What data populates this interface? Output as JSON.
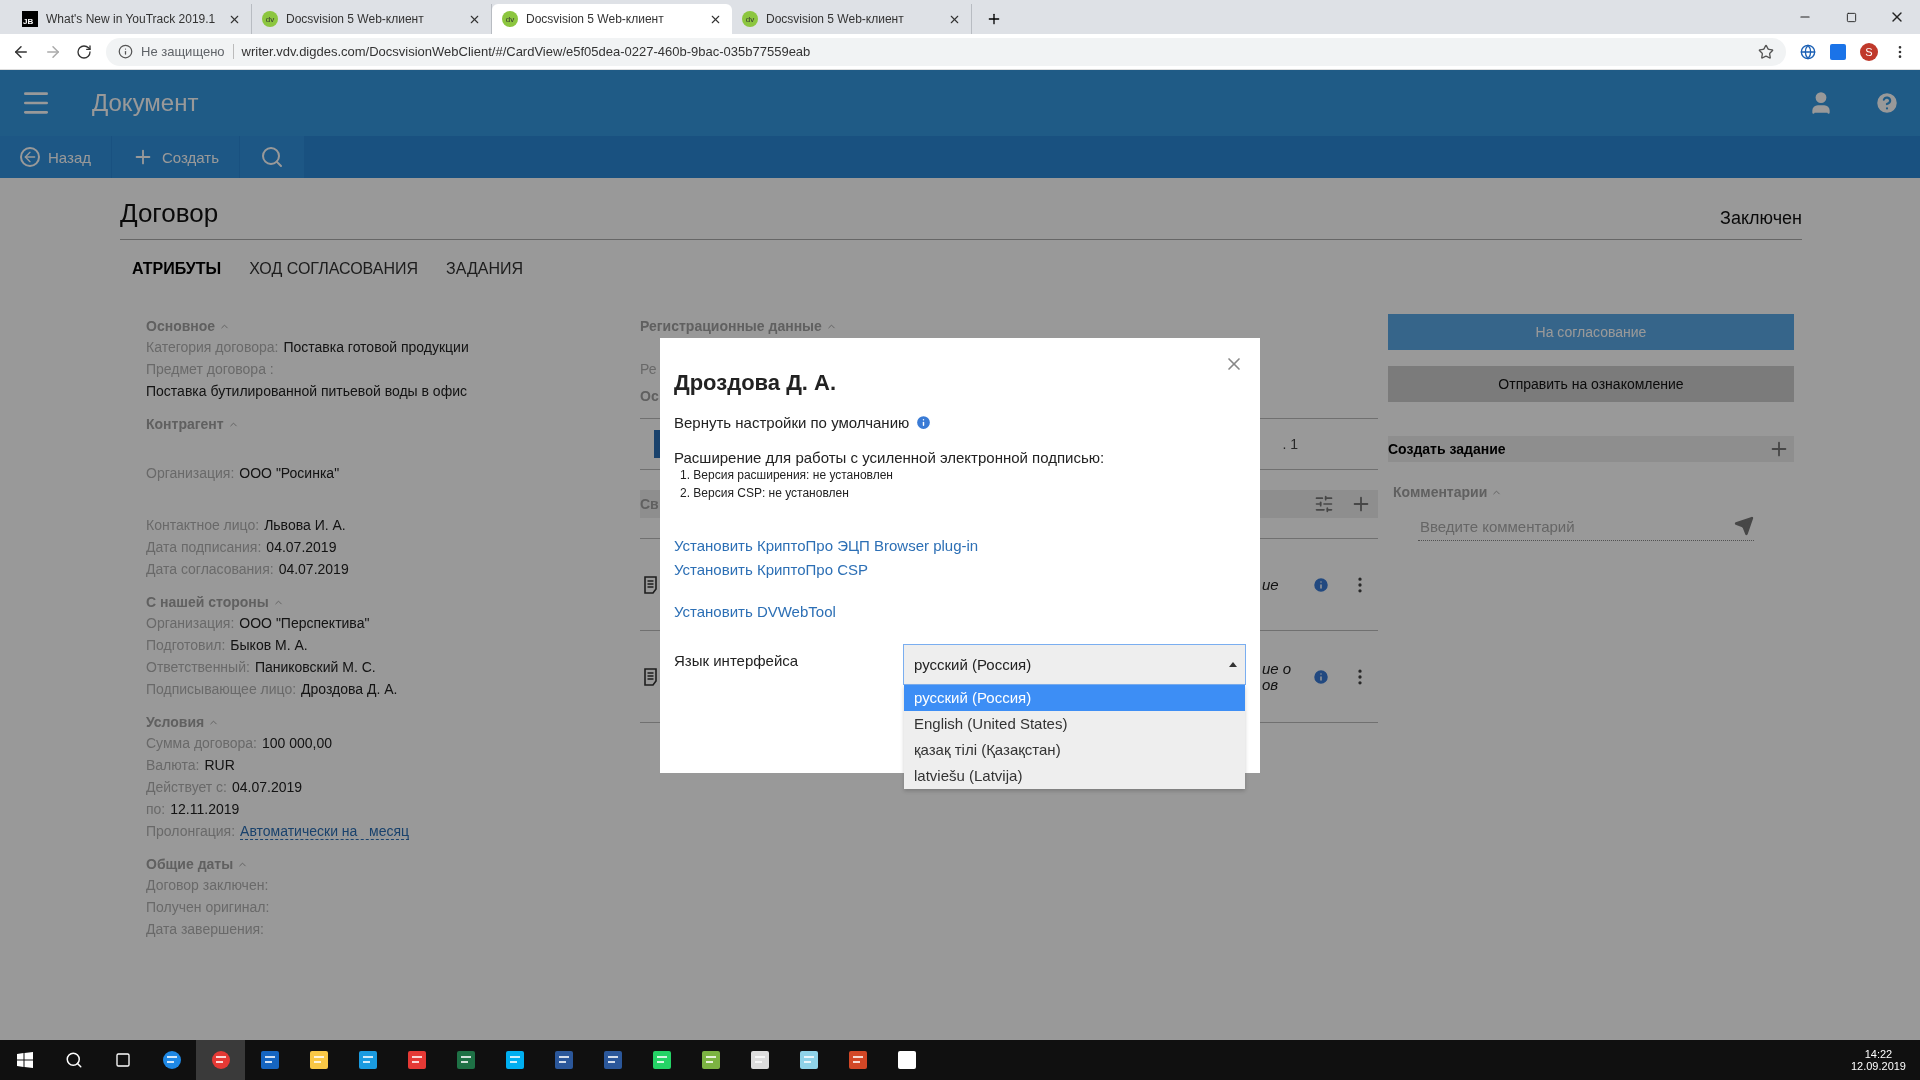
{
  "browser": {
    "tabs": [
      {
        "kind": "jb",
        "badge": "JB",
        "label": "What's New in YouTrack 2019.1",
        "selected": false
      },
      {
        "kind": "dv",
        "badge": "dv",
        "label": "Docsvision 5 Web-клиент",
        "selected": false
      },
      {
        "kind": "dv",
        "badge": "dv",
        "label": "Docsvision 5 Web-клиент",
        "selected": true
      },
      {
        "kind": "dv",
        "badge": "dv",
        "label": "Docsvision 5 Web-клиент",
        "selected": false
      }
    ],
    "security": "Не защищено",
    "url": "writer.vdv.digdes.com/DocsvisionWebClient/#/CardView/e5f05dea-0227-460b-9bac-035b77559eab",
    "avatar": "S"
  },
  "app": {
    "title": "Документ",
    "toolbar": [
      {
        "kind": "back",
        "label": "Назад"
      },
      {
        "kind": "create",
        "label": "Создать"
      },
      {
        "kind": "scan"
      }
    ]
  },
  "document": {
    "title": "Договор",
    "status": "Заключен",
    "tabs": [
      {
        "label": "АТРИБУТЫ",
        "selected": true
      },
      {
        "label": "ХОД СОГЛАСОВАНИЯ",
        "selected": false
      },
      {
        "label": "ЗАДАНИЯ",
        "selected": false
      }
    ],
    "sections": [
      {
        "title": "Основное",
        "fields": [
          {
            "label": "Категория договора:",
            "value": "Поставка готовой продукции"
          },
          {
            "label": "Предмет договора :",
            "value": "Поставка бутилированной питьевой воды в офис",
            "kind": "block"
          }
        ]
      },
      {
        "title": "Контрагент",
        "fields": [
          {
            "label": "Организация:",
            "value": "ООО \"Росинка\"",
            "kind": "spaced"
          },
          {
            "label": "Контактное лицо:",
            "value": "Львова И. А.",
            "kind": "spaced"
          },
          {
            "label": "Дата подписания:",
            "value": "04.07.2019"
          },
          {
            "label": "Дата согласования:",
            "value": "04.07.2019"
          }
        ]
      },
      {
        "title": "С нашей стороны",
        "fields": [
          {
            "label": "Организация:",
            "value": "ООО \"Перспектива\""
          },
          {
            "label": "Подготовил:",
            "value": "Быков М. А."
          },
          {
            "label": "Ответственный:",
            "value": "Паниковский М. С."
          },
          {
            "label": "Подписывающее лицо:",
            "value": "Дроздова Д. А."
          }
        ]
      },
      {
        "title": "Условия",
        "fields": [
          {
            "label": "Сумма договора:",
            "value": "100 000,00"
          },
          {
            "label": "Валюта:",
            "value": "RUR"
          },
          {
            "label": "Действует с:",
            "value": "04.07.2019"
          },
          {
            "label": "по:",
            "value": "12.11.2019"
          },
          {
            "label": "Пролонгация:",
            "value": "Автоматически на   месяц",
            "kind": "link"
          }
        ]
      },
      {
        "title": "Общие даты",
        "fields": [
          {
            "label": "Договор заключен:"
          },
          {
            "label": "Получен оригинал:"
          },
          {
            "label": "Дата завершения:"
          }
        ]
      }
    ],
    "middle": {
      "header": "Регистрационные данные",
      "line_fragment": "Ре",
      "section_fragment": "Ос",
      "tab_fragment": ". 1",
      "band_fragment": "Св",
      "rows": [
        {
          "fragments": [
            "ие"
          ]
        },
        {
          "fragments": [
            "ие о",
            "ов"
          ]
        }
      ]
    },
    "actions": [
      {
        "kind": "primary",
        "label": "На согласование"
      },
      {
        "kind": "secondary",
        "label": "Отправить на ознакомление"
      }
    ],
    "create_task": "Создать задание",
    "comments": {
      "title": "Комментарии",
      "placeholder": "Введите комментарий"
    }
  },
  "dialog": {
    "title": "Дроздова Д. А.",
    "reset": "Вернуть настройки по умолчанию",
    "extension_title": "Расширение для работы с усиленной электронной подписью:",
    "extension_items": [
      "1. Версия расширения: не установлен",
      "2. Версия CSP: не установлен"
    ],
    "links": [
      {
        "label": "Установить КриптоПро ЭЦП Browser plug-in"
      },
      {
        "label": "Установить КриптоПро CSP"
      },
      {
        "label": "Установить DVWebTool",
        "kind": "spaced"
      }
    ],
    "language_label": "Язык интерфейса",
    "language": {
      "value": "русский (Россия)",
      "expanded": true,
      "options": [
        {
          "label": "русский (Россия)",
          "selected": true
        },
        {
          "label": "English (United States)",
          "selected": false
        },
        {
          "label": "қазақ тілі (Қазақстан)",
          "selected": false
        },
        {
          "label": "latviešu (Latvija)",
          "selected": false
        }
      ]
    }
  },
  "taskbar": {
    "time": "14:22",
    "date": "12.09.2019"
  }
}
